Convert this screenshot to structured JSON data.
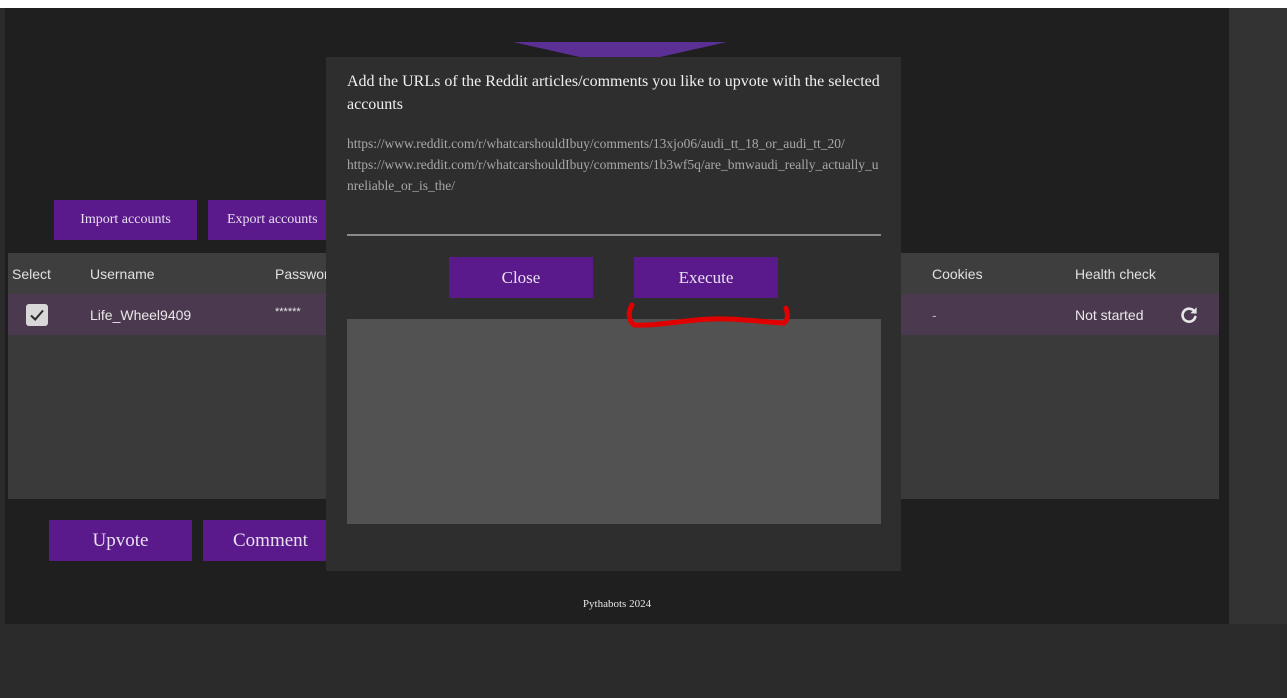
{
  "toolbar": {
    "import_label": "Import accounts",
    "export_label": "Export accounts"
  },
  "table": {
    "headers": {
      "select": "Select",
      "username": "Username",
      "password": "Passwor",
      "cookies": "Cookies",
      "health_check": "Health check"
    },
    "rows": [
      {
        "selected": true,
        "username": "Life_Wheel9409",
        "password": "******",
        "cookies": "-",
        "health_check": "Not started"
      }
    ]
  },
  "actions": {
    "upvote_label": "Upvote",
    "comment_label": "Comment"
  },
  "modal": {
    "title": "Add the URLs of the Reddit articles/comments you like to upvote with the selected accounts",
    "urls_value": "https://www.reddit.com/r/whatcarshouldIbuy/comments/13xjo06/audi_tt_18_or_audi_tt_20/\nhttps://www.reddit.com/r/whatcarshouldIbuy/comments/1b3wf5q/are_bmwaudi_really_actually_unreliable_or_is_the/",
    "close_label": "Close",
    "execute_label": "Execute"
  },
  "footer": {
    "text": "Pythabots 2024"
  },
  "icons": {
    "checkbox": "check-icon",
    "refresh": "refresh-icon"
  },
  "colors": {
    "accent": "#5a1a8c",
    "window_bg": "#1f1f1f",
    "panel_bg": "#3a3a3a",
    "row_selected_bg": "#4b3a4f",
    "modal_bg": "#2e2e2e",
    "annotation": "#e00000"
  }
}
